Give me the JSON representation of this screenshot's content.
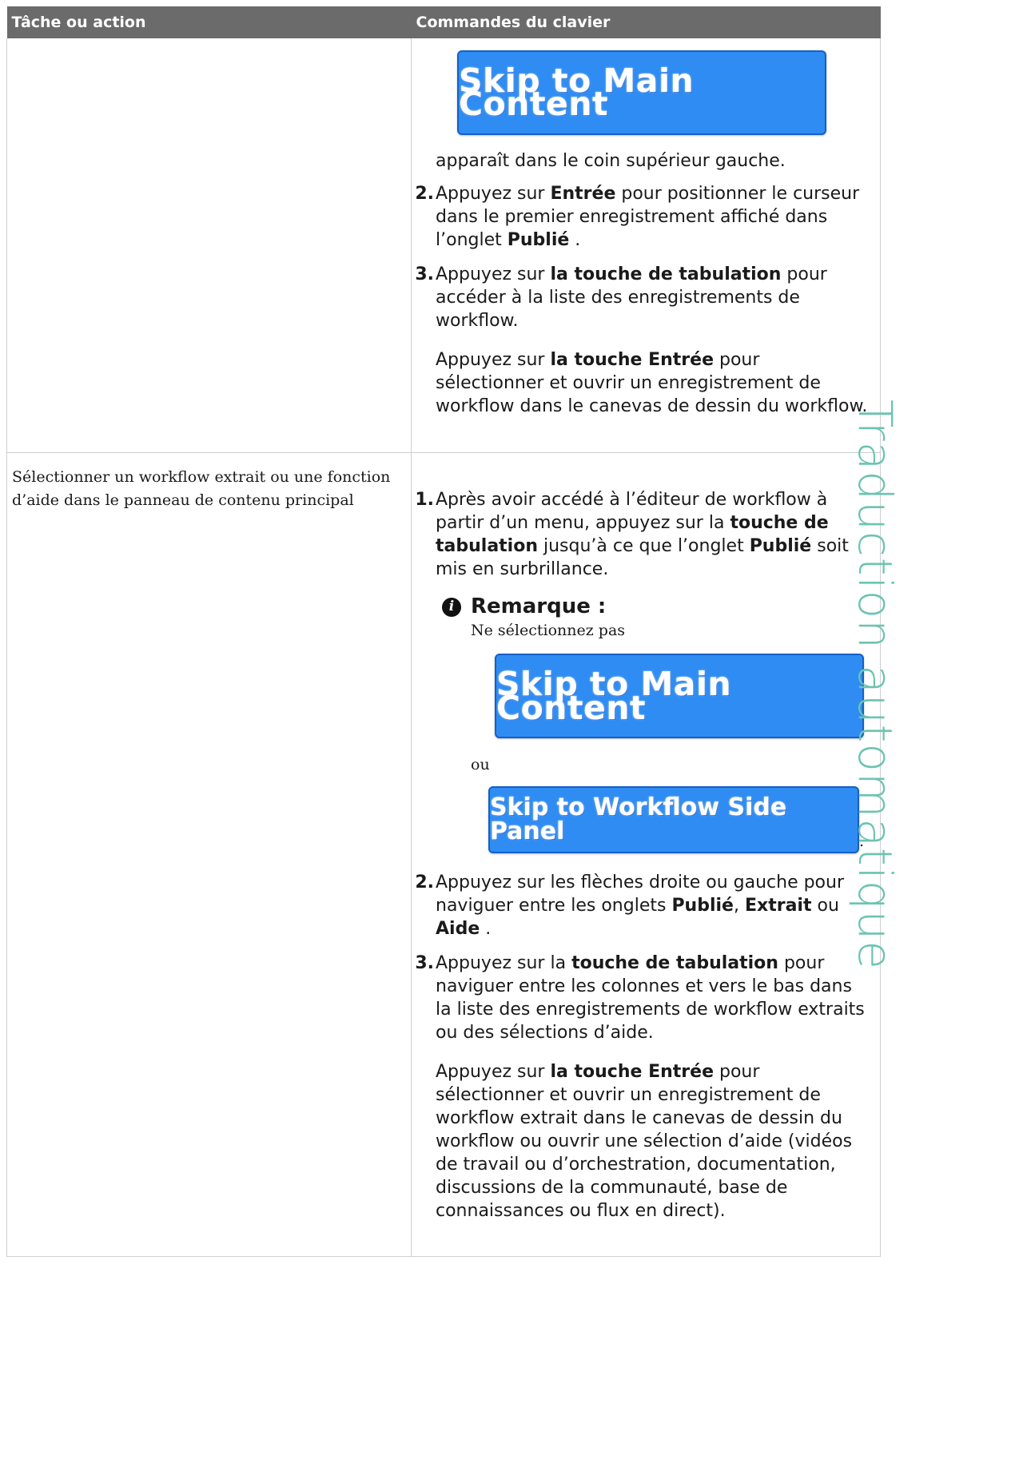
{
  "table": {
    "headers": [
      "Tâche ou action",
      "Commandes du clavier"
    ],
    "rows": [
      {
        "task": "",
        "skip_button": "Skip to Main Content",
        "lead_text": "apparaît dans le coin supérieur gauche.",
        "steps": [
          {
            "number": "2.",
            "segments": [
              "Appuyez sur ",
              "Entrée",
              " pour positionner le curseur dans le premier enregistrement affiché dans l’onglet ",
              "Publié",
              " ."
            ]
          },
          {
            "number": "3.",
            "segments": [
              "Appuyez sur ",
              "la touche de tabulation",
              " pour accéder à la liste des enregistrements de workflow."
            ],
            "para_segments": [
              "Appuyez sur ",
              "la touche Entrée",
              " pour sélectionner et ouvrir un enregistrement de workflow dans le canevas de dessin du workflow."
            ]
          }
        ]
      },
      {
        "task": "Sélectionner un workflow extrait ou une fonction d’aide dans le panneau de contenu principal",
        "steps": [
          {
            "number": "1.",
            "segments": [
              "Après avoir accédé à l’éditeur de workflow à partir d’un menu, appuyez sur la ",
              "touche de tabulation",
              " jusqu’à ce que l’onglet ",
              "Publié",
              " soit mis en surbrillance."
            ],
            "note": {
              "icon": "info-icon",
              "title": "Remarque :",
              "text": "Ne sélectionnez pas",
              "button_1": "Skip to Main Content",
              "or_text": "ou",
              "button_2": "Skip to Workflow Side Panel",
              "end_text": "."
            }
          },
          {
            "number": "2.",
            "segments": [
              "Appuyez sur les flèches droite ou gauche pour naviguer entre les onglets ",
              "Publié",
              ", ",
              "Extrait",
              " ou ",
              "Aide",
              " ."
            ]
          },
          {
            "number": "3.",
            "segments": [
              "Appuyez sur la ",
              "touche de tabulation",
              " pour naviguer entre les colonnes et vers le bas dans la liste des enregistrements de workflow extraits ou des sélections d’aide."
            ],
            "para_segments": [
              "Appuyez sur ",
              "la touche Entrée",
              " pour sélectionner et ouvrir un enregistrement de workflow extrait dans le canevas de dessin du workflow ou ouvrir une sélection d’aide (vidéos de travail ou d’orchestration, documentation, discussions de la communauté, base de connaissances ou flux en direct)."
            ]
          }
        ]
      }
    ]
  },
  "watermark": "Traduction automatique",
  "colors": {
    "header_bg": "#6b6b6b",
    "skip_button_bg": "#2f8cf3",
    "watermark": "#6bc4b1"
  }
}
